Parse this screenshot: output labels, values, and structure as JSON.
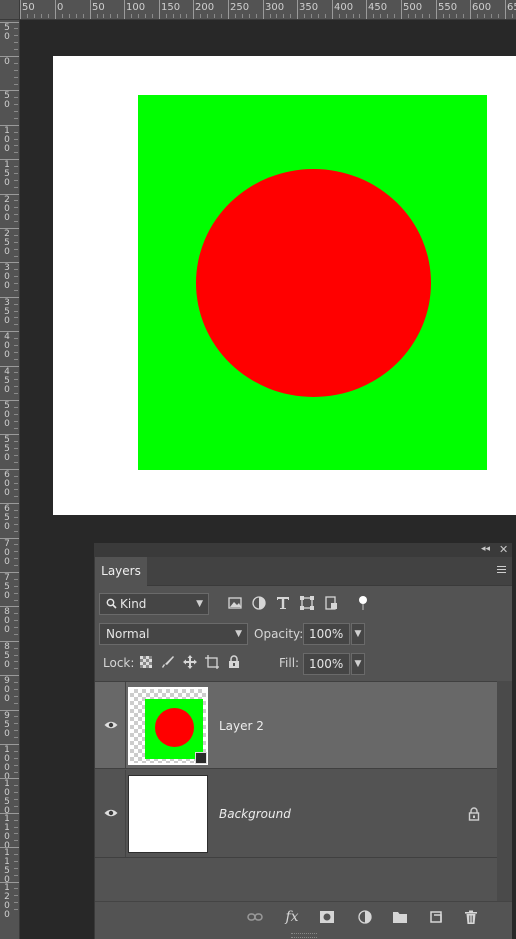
{
  "ruler": {
    "top_labels": [
      "50",
      "0",
      "50",
      "100",
      "150",
      "200",
      "250",
      "300",
      "350",
      "400",
      "450",
      "500",
      "550",
      "600",
      "650"
    ],
    "left_labels": [
      "50",
      "0",
      "50",
      "100",
      "150",
      "200",
      "250",
      "300",
      "350",
      "400",
      "450",
      "500",
      "550",
      "600",
      "650",
      "700",
      "750",
      "800",
      "850",
      "900",
      "950",
      "1000",
      "1050",
      "1100",
      "1150",
      "1200"
    ]
  },
  "canvas": {
    "background_color": "#ffffff",
    "rect_color": "#00ff00",
    "circle_color": "#ff0000"
  },
  "layers_panel": {
    "tab_label": "Layers",
    "filter": {
      "kind_label": "Kind",
      "icons": [
        "image-filter-icon",
        "adjustment-filter-icon",
        "type-filter-icon",
        "shape-filter-icon",
        "smart-object-filter-icon",
        "filter-toggle-icon"
      ]
    },
    "blend_mode": "Normal",
    "opacity_label": "Opacity:",
    "opacity_value": "100%",
    "lock_label": "Lock:",
    "lock_icons": [
      "lock-transparent-pixels-icon",
      "lock-image-pixels-icon",
      "lock-position-icon",
      "lock-artboard-icon",
      "lock-all-icon"
    ],
    "fill_label": "Fill:",
    "fill_value": "100%",
    "layers": [
      {
        "name": "Layer 2",
        "selected": true,
        "visible": true,
        "smart_object": true
      },
      {
        "name": "Background",
        "selected": false,
        "visible": true,
        "locked": true
      }
    ],
    "bottom_icons": [
      "link-layers-icon",
      "fx-icon",
      "add-mask-icon",
      "adjustment-layer-icon",
      "new-group-icon",
      "new-layer-icon",
      "delete-layer-icon"
    ],
    "fx_text": "fx"
  }
}
